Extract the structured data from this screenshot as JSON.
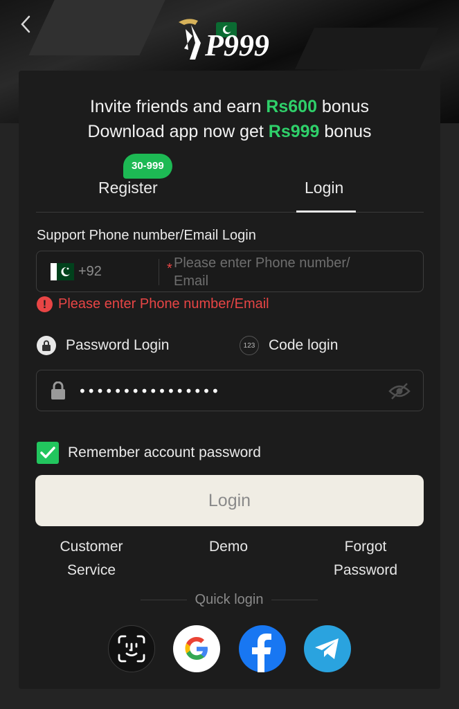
{
  "header": {
    "back_icon": "chevron-left-icon",
    "logo_text": "P999"
  },
  "promo": {
    "line1_prefix": "Invite friends and earn ",
    "line1_amount": "Rs600",
    "line1_suffix": " bonus",
    "line2_prefix": "Download app now get ",
    "line2_amount": "Rs999",
    "line2_suffix": " bonus"
  },
  "tabs": {
    "register_label": "Register",
    "register_badge": "30-999",
    "login_label": "Login",
    "active": "login"
  },
  "phone": {
    "label": "Support Phone number/Email Login",
    "country_code": "+92",
    "placeholder": "Please enter Phone number/\nEmail",
    "required_mark": "*",
    "error": "Please enter Phone number/Email",
    "error_icon": "!"
  },
  "login_modes": {
    "password_label": "Password Login",
    "code_label": "Code login",
    "code_icon_text": "123"
  },
  "password": {
    "value": "••••••••••••••••"
  },
  "remember": {
    "label": "Remember account password",
    "checked": true
  },
  "login_button": "Login",
  "links": {
    "customer_service_1": "Customer",
    "customer_service_2": "Service",
    "demo": "Demo",
    "forgot_1": "Forgot",
    "forgot_2": "Password"
  },
  "quick_login": {
    "label": "Quick login",
    "providers": [
      "face-id",
      "google",
      "facebook",
      "telegram"
    ]
  },
  "colors": {
    "accent_green": "#2fd06a",
    "error_red": "#e84545",
    "facebook_blue": "#1877f2",
    "telegram_blue": "#2aa3df"
  }
}
